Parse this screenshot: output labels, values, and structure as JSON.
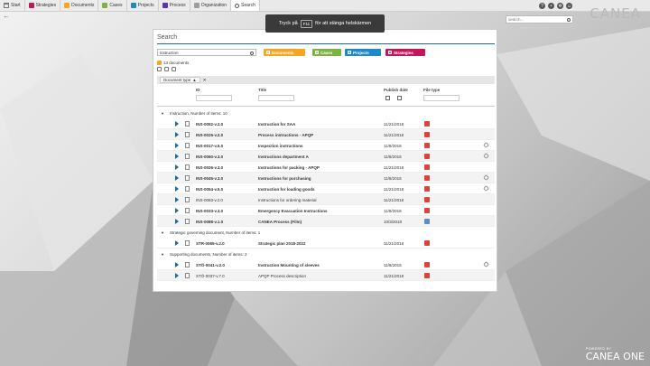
{
  "nav": {
    "tabs": [
      {
        "label": "Start",
        "color": "#9e9e9e"
      },
      {
        "label": "Strategies",
        "color": "#c2185b"
      },
      {
        "label": "Documents",
        "color": "#f5a623"
      },
      {
        "label": "Cases",
        "color": "#7cb342"
      },
      {
        "label": "Projects",
        "color": "#1e88c8"
      },
      {
        "label": "Process",
        "color": "#5e35b1"
      },
      {
        "label": "Organization",
        "color": "#9e9e9e"
      },
      {
        "label": "Search",
        "color": "#555555"
      }
    ],
    "global_search_placeholder": "search...",
    "logo": "CANEA"
  },
  "toast": {
    "prefix": "Tryck på",
    "key": "F11",
    "suffix": "för att stänga helskärmen"
  },
  "search": {
    "title": "Search",
    "query": "instruction",
    "filters": [
      {
        "label": "Documents",
        "color": "#f5a623"
      },
      {
        "label": "Cases",
        "color": "#7cb342"
      },
      {
        "label": "Projects",
        "color": "#1e88c8"
      },
      {
        "label": "Strategies",
        "color": "#c2185b"
      }
    ],
    "result_count": "13 documents",
    "grouping_chip": "Document type"
  },
  "table": {
    "headers": {
      "id": "ID",
      "title": "Title",
      "publish": "Publish date",
      "filetype": "File type"
    },
    "groups": [
      {
        "label": "Instruction, Number of items: 10",
        "rows": [
          {
            "id": "INS-0052-v.2.0",
            "title": "Instruction for SAA",
            "date": "11/21/2018",
            "bold": true,
            "file": "pdf",
            "link": false
          },
          {
            "id": "INS-0025-v.2.0",
            "title": "Process instructions - APQP",
            "date": "11/21/2018",
            "bold": true,
            "file": "pdf",
            "link": false
          },
          {
            "id": "INS-0017-v.5.0",
            "title": "Inspection instructions",
            "date": "11/8/2018",
            "bold": true,
            "file": "pdf",
            "link": true
          },
          {
            "id": "INS-0060-v.3.0",
            "title": "Instructions department A",
            "date": "11/8/2018",
            "bold": true,
            "file": "pdf",
            "link": true
          },
          {
            "id": "INS-0026-v.3.0",
            "title": "Instructions for packing - APQP",
            "date": "11/21/2018",
            "bold": true,
            "file": "pdf",
            "link": false
          },
          {
            "id": "INS-0045-v.3.0",
            "title": "Instructions for purchasing",
            "date": "11/8/2018",
            "bold": true,
            "file": "pdf",
            "link": true
          },
          {
            "id": "INS-0054-v.5.0",
            "title": "Instruction for loading goods",
            "date": "11/21/2018",
            "bold": true,
            "file": "pdf",
            "link": true
          },
          {
            "id": "INS-0083-v.2.0",
            "title": "Instructions for ordering material",
            "date": "11/21/2018",
            "bold": false,
            "file": "pdf",
            "link": false
          },
          {
            "id": "INS-0033-v.3.0",
            "title": "Emergency Evacuation Instructions",
            "date": "11/8/2018",
            "bold": true,
            "file": "pdf",
            "link": false
          },
          {
            "id": "INS-0088-v.1.0",
            "title": "CANEA Process (Film)",
            "date": "10/3/2018",
            "bold": true,
            "file": "video",
            "link": false
          }
        ]
      },
      {
        "label": "Strategic governing document, Number of items: 1",
        "rows": [
          {
            "id": "STR-0065-v.2.0",
            "title": "Strategic plan 2018-2022",
            "date": "11/21/2018",
            "bold": true,
            "file": "pdf",
            "link": false
          }
        ]
      },
      {
        "label": "Supporting documents, Number of items: 2",
        "rows": [
          {
            "id": "STÖ-0041-v.2.0",
            "title": "Instruction Mounting of sleeves",
            "date": "11/8/2018",
            "bold": true,
            "file": "pdf",
            "link": true
          },
          {
            "id": "STÖ-0037-v.7.0",
            "title": "APQP Process description",
            "date": "11/21/2018",
            "bold": false,
            "file": "pdf",
            "link": false
          }
        ]
      }
    ]
  },
  "footer": {
    "powered": "POWERED BY",
    "brand": "CANEA ONE"
  }
}
